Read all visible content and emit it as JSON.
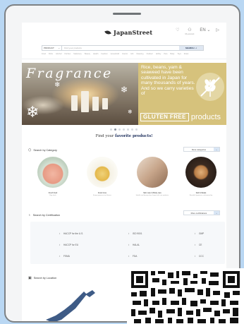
{
  "header": {
    "logo_text": "JapanStreet",
    "account_label": "My account",
    "lang_label": "EN"
  },
  "search": {
    "scope_label": "PRODUCT",
    "placeholder": "Find your products",
    "button_label": "SEARCH"
  },
  "category_links": [
    "Food",
    "Drink",
    "Alcohol",
    "Kitchen",
    "Stationery",
    "Beauty",
    "Health",
    "Fashion",
    "Household",
    "Interior",
    "Gift",
    "Cleaning",
    "Outdoor",
    "Hobby",
    "Pets",
    "Baby",
    "Toys",
    "Music"
  ],
  "banner": {
    "headline": "Fragrance",
    "copy": "Rice, beans, yam & seaweed have been cultivated in Japan for many thousands of years. And so we carry varieties of",
    "badge": "GLUTEN FREE",
    "products_word": "products"
  },
  "find_prefix": "Find your ",
  "find_bold": "favorite products!",
  "category_section": {
    "title": "Search by Category",
    "more_label": "More categories",
    "items": [
      {
        "name": "Fresh food",
        "sub": "Buy fresh"
      },
      {
        "name": "Food zone",
        "sub": "Enjoy japanese tea flavors"
      },
      {
        "name": "Skin care & Body care",
        "sub": "Health and beauty from Japan with our products"
      },
      {
        "name": "Deli & Meals",
        "sub": "Beautiful japanese craftsmanship"
      }
    ]
  },
  "cert_section": {
    "title": "Search by Certification",
    "more_label": "More certifications",
    "items": [
      "HACCP for the U.S.",
      "ISO 9001",
      "GMP",
      "HACCP for EU",
      "HALAL",
      "CE",
      "FSMA",
      "FDA",
      "CCC"
    ]
  },
  "location_section": {
    "title": "Search by Location"
  },
  "colors": {
    "page_bg": "#b9d7f3",
    "banner_gold": "#d6c27c",
    "button_bg": "#d9e6f5",
    "accent_navy": "#1d2f5c"
  },
  "icons": [
    "search-icon",
    "heart-icon",
    "user-icon",
    "chevron-down-icon",
    "cart-icon",
    "gluten-free-icon",
    "category-icon",
    "certificate-icon",
    "location-icon",
    "qr-code-icon"
  ]
}
